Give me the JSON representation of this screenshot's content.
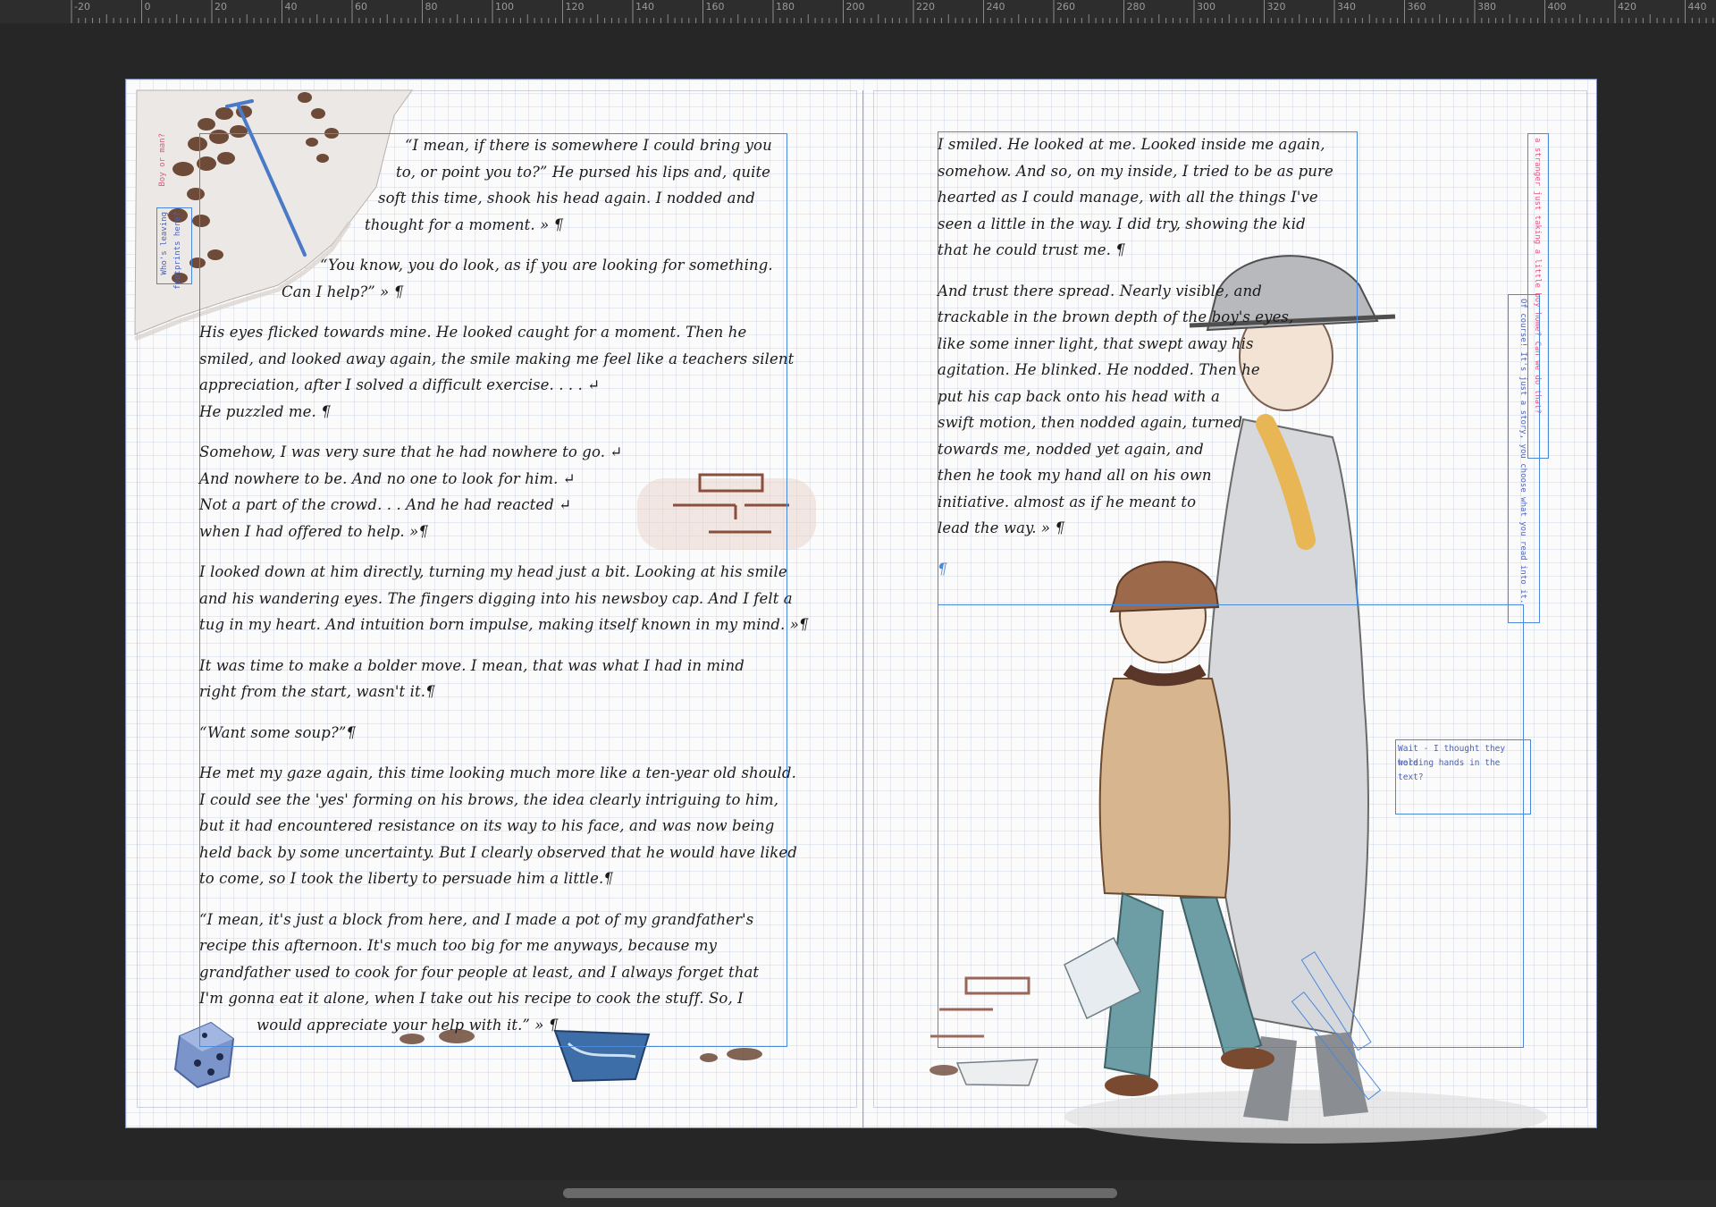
{
  "ruler": {
    "labels": [
      "-20",
      "0",
      "20",
      "40",
      "60",
      "80",
      "100",
      "120",
      "140",
      "160",
      "180",
      "200",
      "220",
      "240",
      "260",
      "280",
      "300",
      "320",
      "340",
      "360",
      "380",
      "400",
      "420",
      "440"
    ]
  },
  "left_page": {
    "margin_notes": {
      "boy_or_man": "Boy or man?",
      "whos_leaving": "Who's leaving",
      "footprints_here": "footprints here?"
    },
    "paragraphs": [
      [
        "“I mean, if there is somewhere I could bring you",
        "to, or point you to?” He pursed his lips and, quite",
        "soft this time, shook his head again. I nodded and",
        "thought for a moment. » ¶"
      ],
      [
        "“You know, you do look, as if you are looking for something.",
        "Can I help?” » ¶"
      ],
      [
        "His eyes flicked towards mine. He looked caught for a moment. Then he",
        "smiled, and looked away again, the smile making me feel like a teachers silent",
        "appreciation, after I solved a difficult exercise. . . . ↵",
        "He puzzled me. ¶"
      ],
      [
        "Somehow, I was very sure that he had nowhere to go. ↵",
        "And nowhere to be. And no one to look for him. ↵",
        "Not a part of the crowd. . . And he had reacted ↵",
        "when I had offered to help. »¶"
      ],
      [
        "I looked down at him directly, turning my head just a bit. Looking at his smile",
        "and his wandering eyes. The fingers digging into his newsboy cap. And I felt a",
        "tug in my heart. And intuition born impulse, making itself known in my mind. »¶"
      ],
      [
        "It was time to make a bolder move. I mean, that was what I had in mind",
        "right from the start, wasn't it.¶"
      ],
      [
        "“Want some soup?”¶"
      ],
      [
        "He met my gaze again, this time looking much more like a ten-year old should.",
        "I could see the 'yes' forming on his brows, the idea clearly intriguing to him,",
        "but it had encountered resistance on its way to his face, and was now being",
        "held back by some uncertainty. But I clearly observed that he would have liked",
        "to come, so I took the liberty to persuade him a little.¶"
      ],
      [
        "“I mean, it's just a block from here, and I made a pot of my grandfather's",
        "recipe this afternoon. It's much too big for me anyways, because my",
        "grandfather used to cook for four people at least, and I always forget that",
        "I'm gonna eat it alone, when I take out his recipe to cook the stuff. So, I",
        "would appreciate your help with it.” » ¶"
      ]
    ]
  },
  "right_page": {
    "paragraphs": [
      [
        "I smiled. He looked at me. Looked inside me again,",
        "somehow. And so, on my inside, I tried to be as pure",
        "hearted as I could manage, with all the things I've",
        "seen a little in the way. I did try, showing the kid",
        "that he could trust me. ¶"
      ],
      [
        "And trust there spread. Nearly visible, and",
        "trackable in the brown depth of the boy's eyes,",
        "like some inner light, that swept away his",
        "agitation. He blinked. He nodded. Then he",
        "put his cap back onto his head with a",
        "swift motion, then nodded again, turned",
        "towards me, nodded yet again, and",
        "then he took my hand all on his own",
        "initiative. almost as if he meant to",
        "lead the way. » ¶"
      ],
      [
        "¶"
      ]
    ],
    "notes": {
      "stranger_pink": "a stranger just taking a little boy home? Can we do that?",
      "of_course": "Of course! It's just a story, you choose what you read into it.",
      "wait_line1": "Wait - I thought they were",
      "wait_line2": "holding hands in the text?"
    }
  },
  "colors": {
    "frame_blue": "#4a88d9",
    "note_pink": "#e2557e",
    "note_blue": "#4d62b8"
  },
  "icons": [
    "footprint-icon",
    "shovel-icon",
    "dice-icon",
    "newspaper-icon",
    "brick-wall-icon",
    "man-figure-icon",
    "boy-figure-icon"
  ]
}
